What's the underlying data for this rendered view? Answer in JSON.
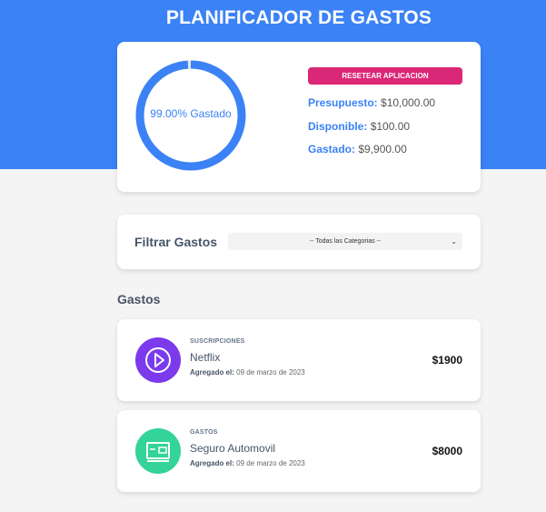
{
  "app": {
    "title": "PLANIFICADOR DE GASTOS"
  },
  "budget": {
    "percent_spent": 99,
    "donut_label": "99.00% Gastado",
    "reset_label": "RESETEAR APLICACION",
    "presupuesto_key": "Presupuesto:",
    "presupuesto_value": "$10,000.00",
    "disponible_key": "Disponible:",
    "disponible_value": "$100.00",
    "gastado_key": "Gastado:",
    "gastado_value": "$9,900.00"
  },
  "filter": {
    "label": "Filtrar Gastos",
    "selected": "-- Todas las Categorias --"
  },
  "expenses_section": {
    "title": "Gastos"
  },
  "expenses": [
    {
      "category": "SUSCRIPCIONES",
      "name": "Netflix",
      "date_key": "Agregado el:",
      "date_value": "09 de marzo de 2023",
      "amount": "$1900",
      "icon": "play-icon",
      "icon_color": "#7c3aed"
    },
    {
      "category": "GASTOS",
      "name": "Seguro Automovil",
      "date_key": "Agregado el:",
      "date_value": "09 de marzo de 2023",
      "amount": "$8000",
      "icon": "money-icon",
      "icon_color": "#34d399"
    }
  ],
  "colors": {
    "primary": "#3b82f6",
    "accent": "#db2777"
  }
}
